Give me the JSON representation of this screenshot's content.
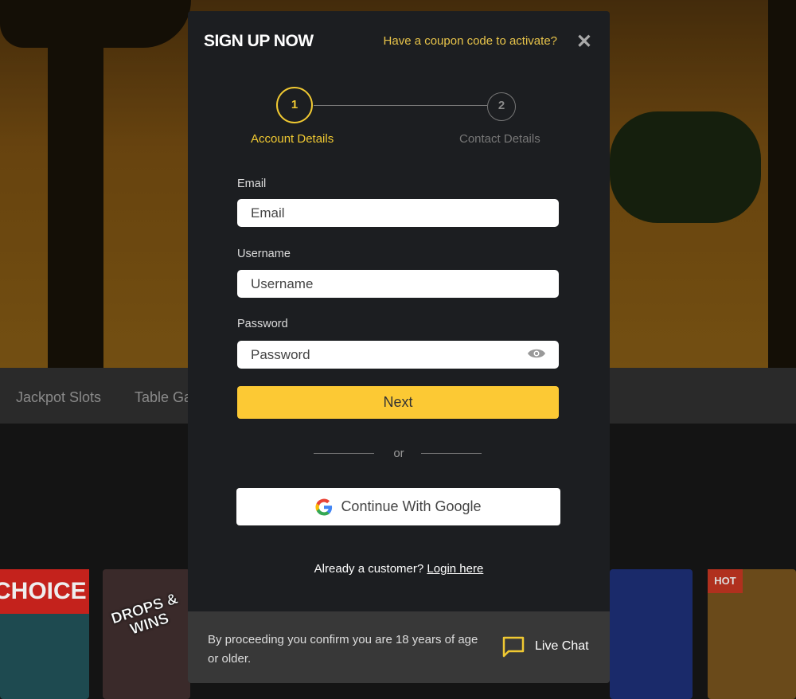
{
  "nav": {
    "items": [
      "Jackpot Slots",
      "Table Games"
    ]
  },
  "tiles": {
    "choice_label": "CHOICE",
    "drops_label": "DROPS & WINS",
    "hot_badge": "HOT"
  },
  "modal": {
    "title": "SIGN UP NOW",
    "coupon_link": "Have a coupon code to activate?",
    "steps": [
      {
        "number": "1",
        "label": "Account Details",
        "active": true
      },
      {
        "number": "2",
        "label": "Contact Details",
        "active": false
      }
    ],
    "fields": {
      "email": {
        "label": "Email",
        "placeholder": "Email",
        "value": ""
      },
      "username": {
        "label": "Username",
        "placeholder": "Username",
        "value": ""
      },
      "password": {
        "label": "Password",
        "placeholder": "Password",
        "value": ""
      }
    },
    "next_label": "Next",
    "or_label": "or",
    "google_label": "Continue With Google",
    "already_text": "Already a customer?",
    "login_link": "Login here",
    "footer_text": "By proceeding you confirm you are 18 years of age or older.",
    "live_chat": "Live Chat"
  },
  "colors": {
    "accent": "#fcc934",
    "modal_bg": "#1c1e21",
    "footer_bg": "#383838"
  }
}
